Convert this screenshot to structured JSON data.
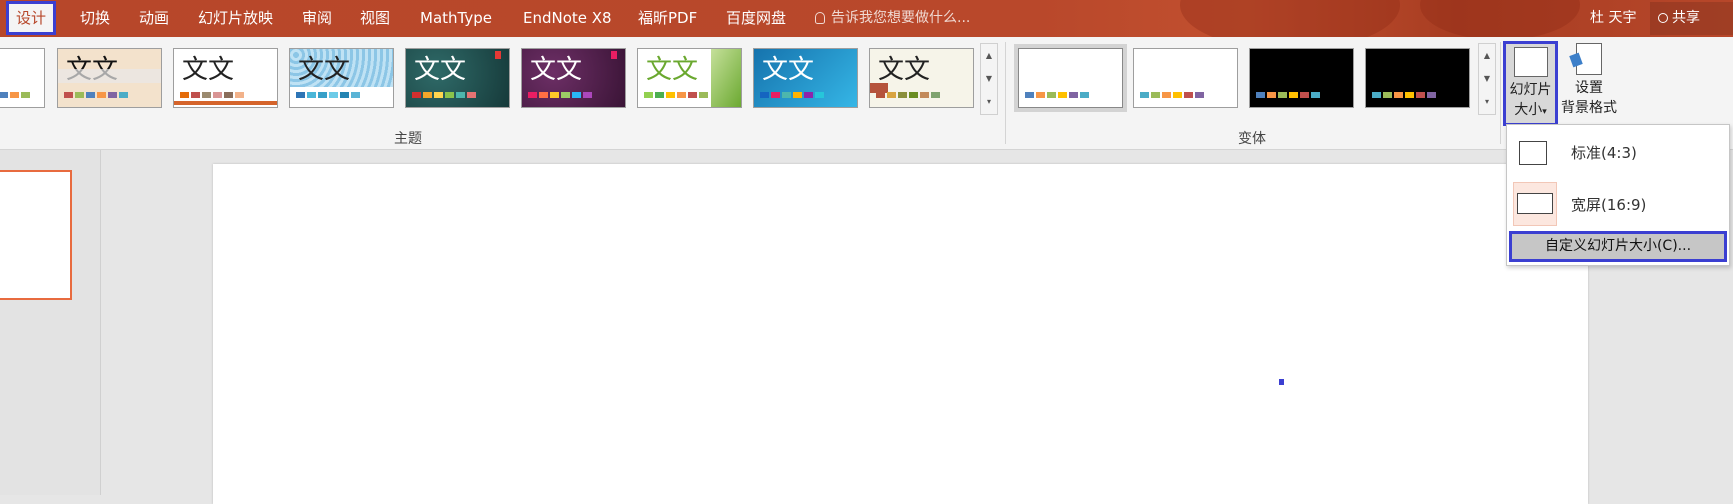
{
  "tabs": [
    {
      "label": "设计",
      "active": true
    },
    {
      "label": "切换"
    },
    {
      "label": "动画"
    },
    {
      "label": "幻灯片放映"
    },
    {
      "label": "审阅"
    },
    {
      "label": "视图"
    },
    {
      "label": "MathType"
    },
    {
      "label": "EndNote X8"
    },
    {
      "label": "福昕PDF"
    },
    {
      "label": "百度网盘"
    }
  ],
  "tell_me": "告诉我您想要做什么...",
  "user_name": "杜 天宇",
  "share_label": "共享",
  "themes": {
    "group_label": "主题",
    "thumb_text": "文文",
    "thumb_text_1": "文文",
    "items": [
      {
        "name": "theme-1",
        "bg": "#f3e2cc",
        "fg": "#111",
        "bar": [
          "#c0504d",
          "#9bbb59",
          "#4f81bd",
          "#f79646",
          "#8064a2",
          "#4bacc6"
        ]
      },
      {
        "name": "theme-2",
        "bg": "#ffffff",
        "fg": "#222",
        "bar": [
          "#e46c0a",
          "#c0504d",
          "#9b8a6f",
          "#d99594",
          "#8a6d5a",
          "#f2b28a"
        ]
      },
      {
        "name": "theme-3",
        "bg": "#a9d4ec",
        "fg": "#222",
        "bar": [
          "#2e75b6",
          "#4ab6d8",
          "#37a0c8",
          "#6ccbe8",
          "#2484b2",
          "#5ab4d6"
        ]
      },
      {
        "name": "theme-4",
        "bg": "#1f4d4d",
        "fg": "#fff",
        "bar": [
          "#d32f2f",
          "#f4a62a",
          "#ffd54f",
          "#8bc34a",
          "#4db6ac",
          "#e57373"
        ]
      },
      {
        "name": "theme-5",
        "bg": "#4d1f48",
        "fg": "#fff",
        "bar": [
          "#e91e63",
          "#ff7043",
          "#ffca28",
          "#9ccc65",
          "#29b6f6",
          "#ab47bc"
        ]
      },
      {
        "name": "theme-6",
        "bg": "#ffffff",
        "fg": "#6aa82f",
        "bar": [
          "#92d050",
          "#4caf50",
          "#ffc000",
          "#f79646",
          "#c0504d",
          "#9bbb59"
        ]
      },
      {
        "name": "theme-7",
        "bg": "#1e8fc7",
        "fg": "#fff",
        "bar": [
          "#1565c0",
          "#e91e63",
          "#4db6ac",
          "#ffb300",
          "#8e24aa",
          "#26c6da"
        ]
      },
      {
        "name": "theme-8",
        "bg": "#f6f4e9",
        "fg": "#222",
        "bar": [
          "#b5533c",
          "#d9a441",
          "#8a8f3c",
          "#6b8e23",
          "#c28a5a",
          "#7fa36f"
        ]
      }
    ]
  },
  "variants": {
    "group_label": "变体",
    "items": [
      {
        "name": "variant-1",
        "bg": "#ffffff",
        "bar": [
          "#4f81bd",
          "#f79646",
          "#9bbb59",
          "#ffc000",
          "#8064a2",
          "#4bacc6"
        ]
      },
      {
        "name": "variant-2",
        "bg": "#ffffff",
        "bar": [
          "#4bacc6",
          "#9bbb59",
          "#f79646",
          "#ffc000",
          "#c0504d",
          "#8064a2"
        ]
      },
      {
        "name": "variant-3",
        "bg": "#000000",
        "bar": [
          "#4f81bd",
          "#f79646",
          "#9bbb59",
          "#ffc000",
          "#c0504d",
          "#4bacc6"
        ]
      },
      {
        "name": "variant-4",
        "bg": "#000000",
        "bar": [
          "#4bacc6",
          "#9bbb59",
          "#f79646",
          "#ffc000",
          "#c0504d",
          "#8064a2"
        ]
      }
    ]
  },
  "buttons": {
    "slide_size_line1": "幻灯片",
    "slide_size_line2": "大小",
    "format_bg_line1": "设置",
    "format_bg_line2": "背景格式"
  },
  "dropdown": {
    "standard": "标准(4:3)",
    "widescreen": "宽屏(16:9)",
    "custom": "自定义幻灯片大小(C)..."
  }
}
